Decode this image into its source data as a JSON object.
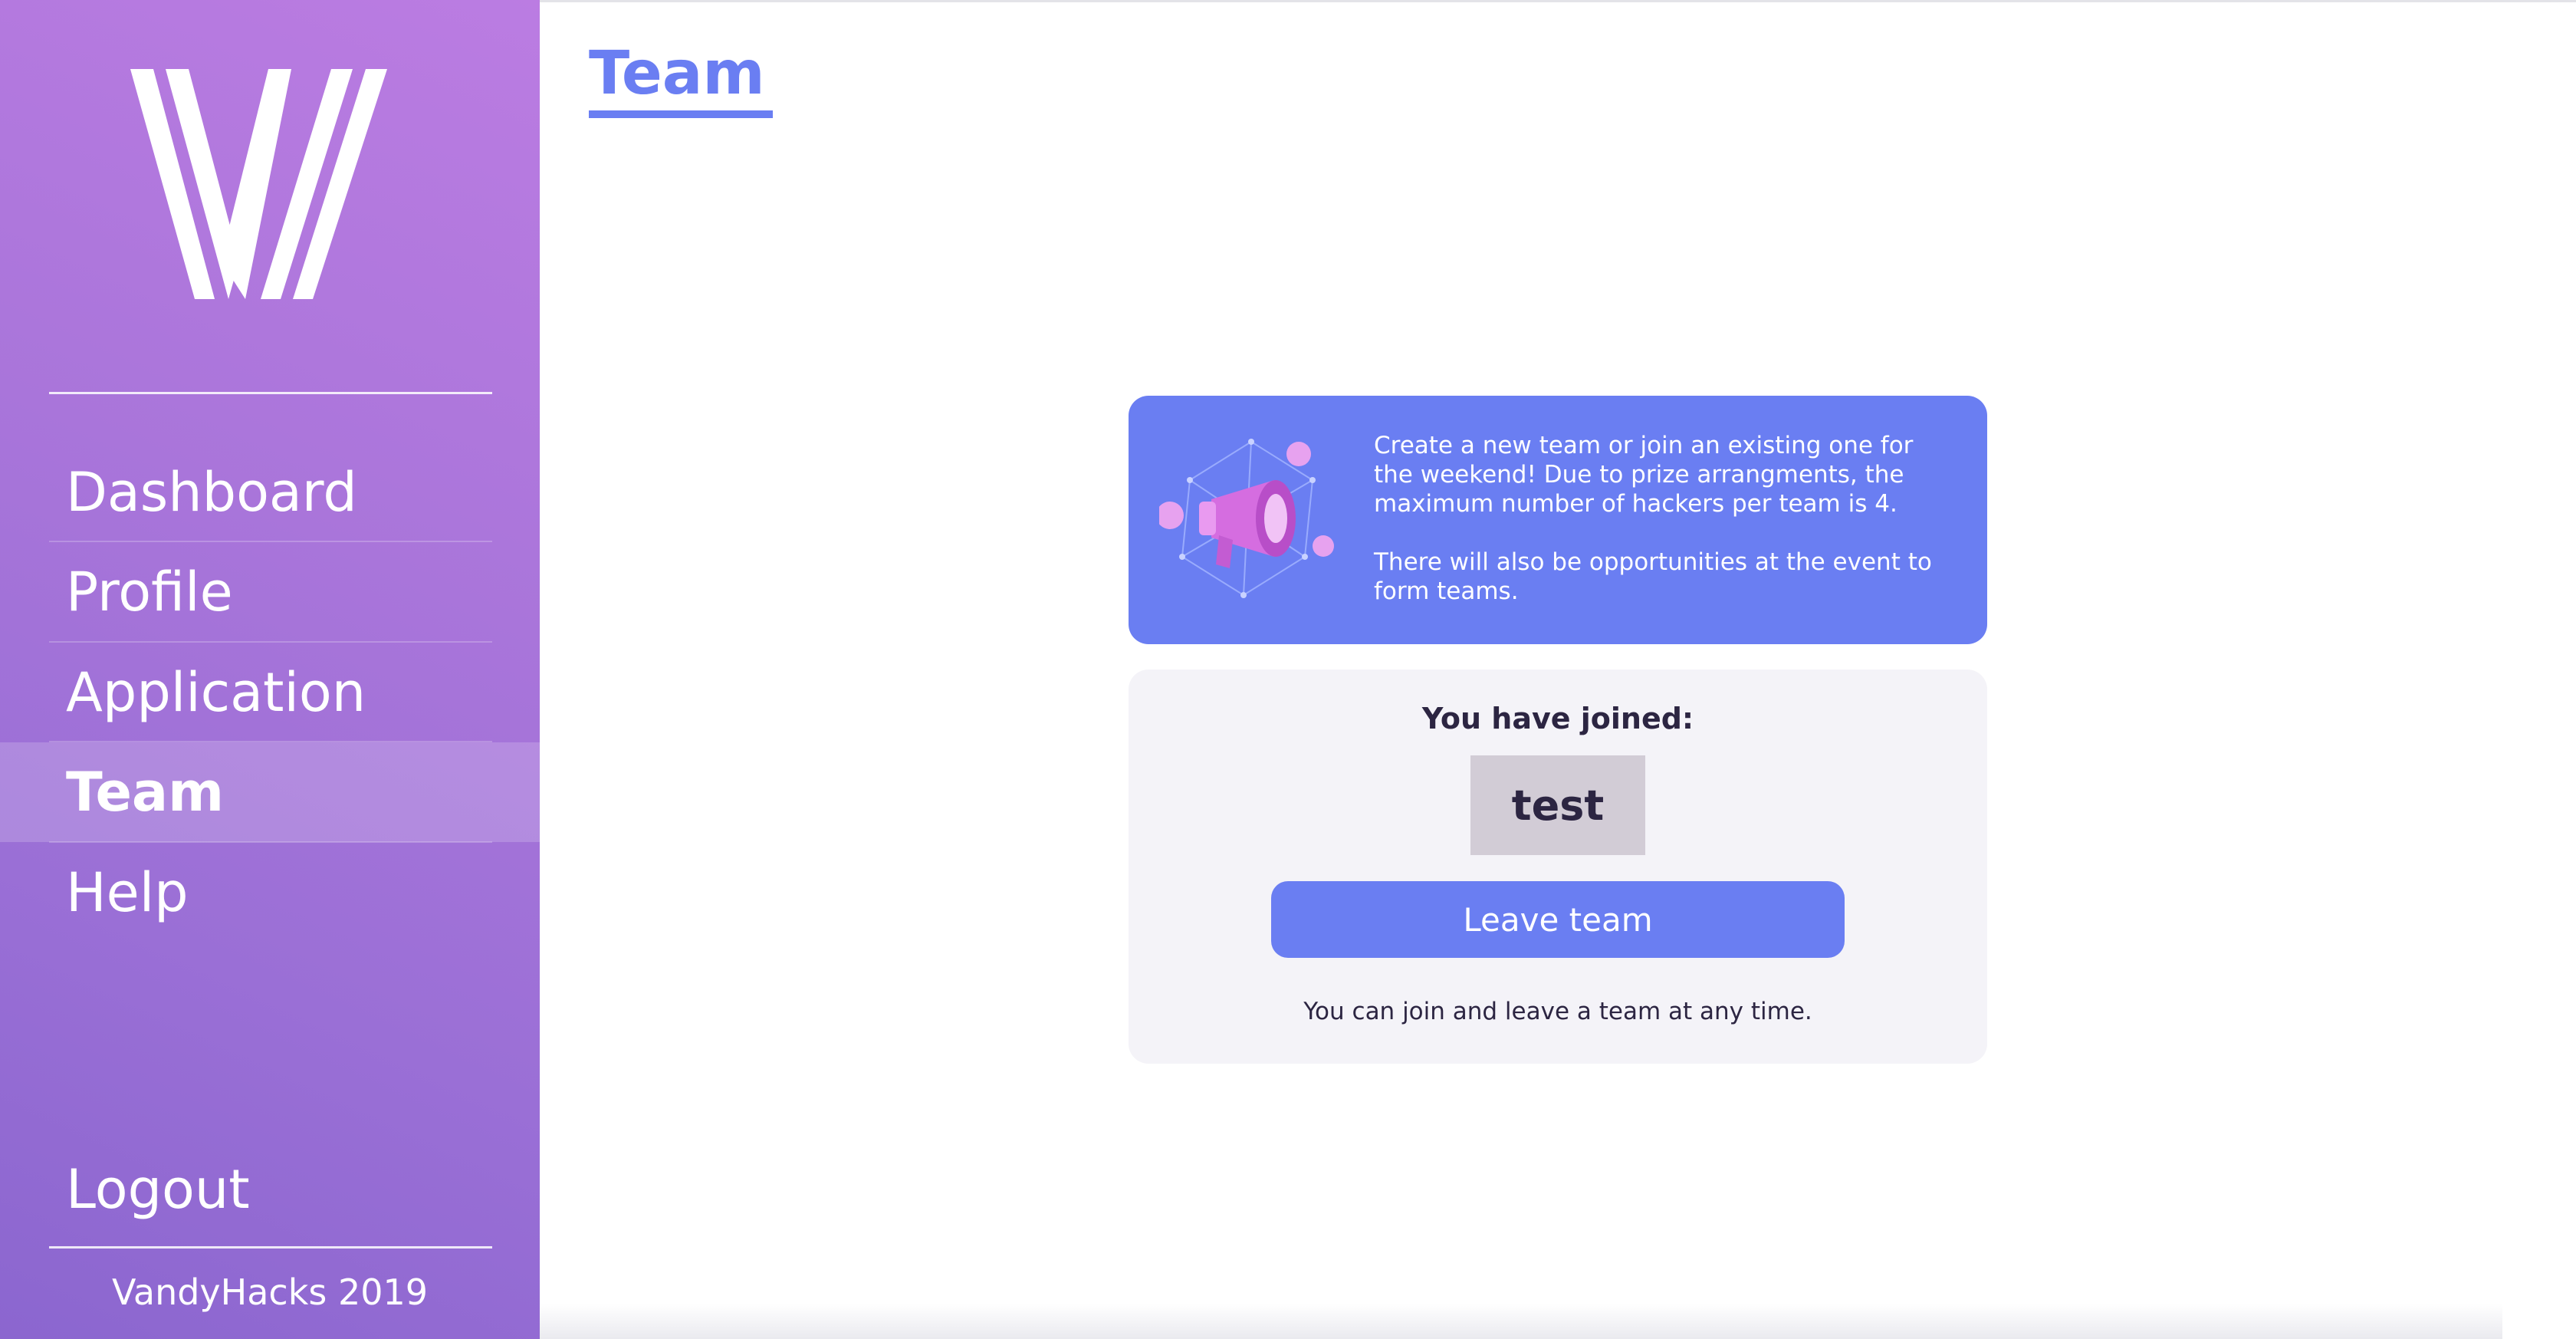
{
  "sidebar": {
    "logo_alt": "VandyHacks logo",
    "nav": [
      {
        "label": "Dashboard",
        "active": false
      },
      {
        "label": "Profile",
        "active": false
      },
      {
        "label": "Application",
        "active": false
      },
      {
        "label": "Team",
        "active": true
      },
      {
        "label": "Help",
        "active": false
      }
    ],
    "logout_label": "Logout",
    "footer": "VandyHacks 2019"
  },
  "header": {
    "title": "Team"
  },
  "info_card": {
    "illustration_icon": "megaphone-icon",
    "paragraph1": "Create a new team or join an existing one for the weekend! Due to prize arrangments, the maximum number of hackers per team is 4.",
    "paragraph2": "There will also be opportunities at the event to form teams."
  },
  "team_card": {
    "joined_label": "You have joined:",
    "team_name": "test",
    "leave_button_label": "Leave team",
    "note": "You can join and leave a team at any time."
  },
  "colors": {
    "accent": "#6a7ef2",
    "sidebar_gradient_top": "#bb7ce2",
    "sidebar_gradient_bottom": "#8b66cf",
    "text_dark": "#2c2542",
    "card_bg": "#f4f3f8",
    "team_box_bg": "#d2ccd6"
  }
}
